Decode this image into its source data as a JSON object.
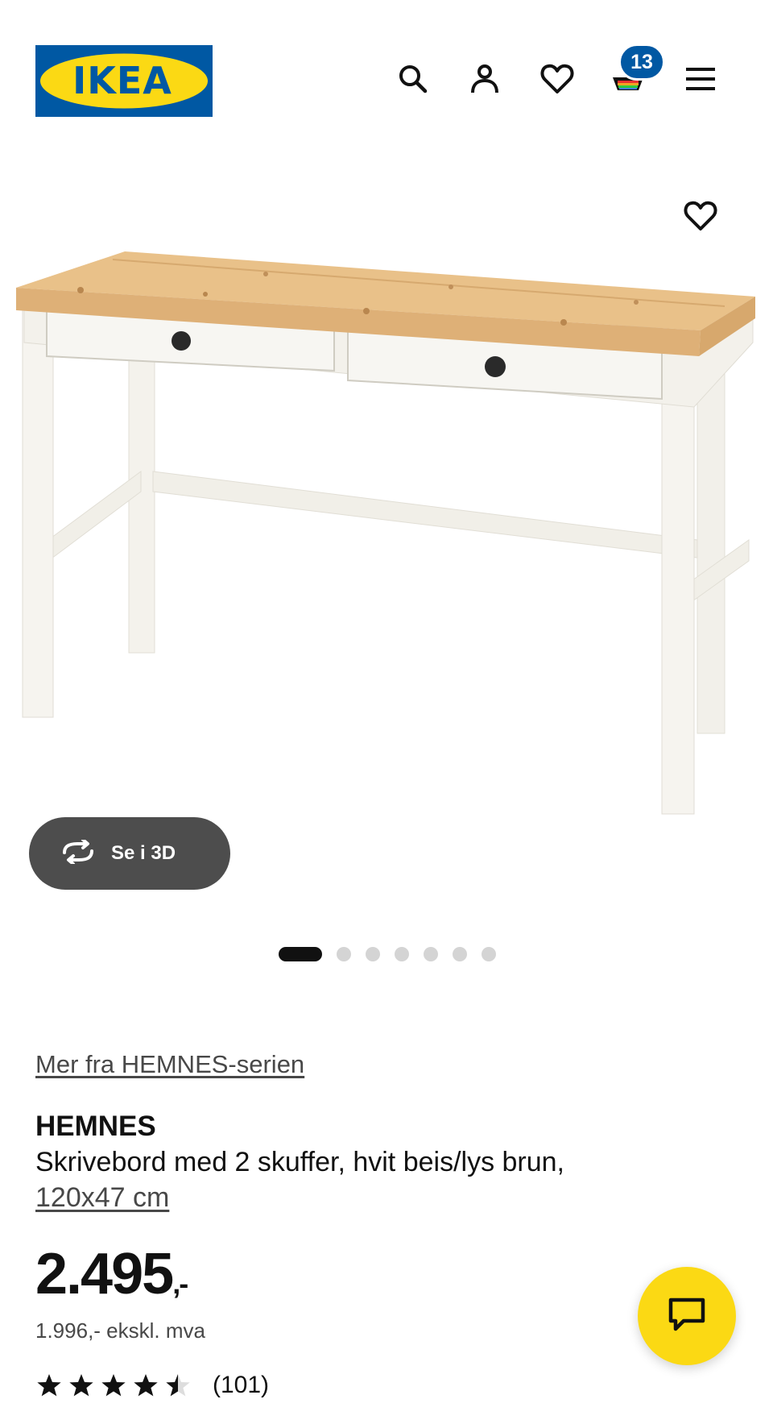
{
  "header": {
    "logo_text": "IKEA",
    "cart_count": "13",
    "icons": [
      "search-icon",
      "profile-icon",
      "heart-icon",
      "shopping-bag-icon",
      "menu-icon"
    ]
  },
  "gallery": {
    "view_3d_label": "Se i 3D",
    "dot_count": 7,
    "active_dot": 1
  },
  "product": {
    "series_link": "Mer fra HEMNES-serien",
    "name": "HEMNES",
    "description": "Skrivebord med 2 skuffer, hvit beis/lys brun,",
    "size": "120x47 cm",
    "price": "2.495",
    "price_suffix": ",-",
    "price_ex_vat": "1.996,- ekskl. mva",
    "rating": 4.5,
    "review_count": "(101)"
  },
  "colors": {
    "ikea_blue": "#0058a3",
    "ikea_yellow": "#fbd914",
    "dark_button": "#4d4d4d"
  }
}
